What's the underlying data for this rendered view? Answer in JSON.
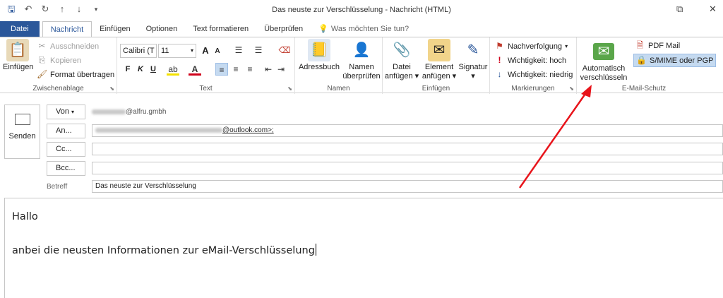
{
  "window": {
    "title": "Das neuste zur Verschlüsselung - Nachricht (HTML)",
    "restore_glyph": "⧉",
    "close_glyph": "✕"
  },
  "qat": [
    "save-icon",
    "undo-icon",
    "redo-icon",
    "up-icon",
    "down-icon",
    "customize-icon"
  ],
  "tabs": {
    "file": "Datei",
    "items": [
      "Nachricht",
      "Einfügen",
      "Optionen",
      "Text formatieren",
      "Überprüfen"
    ],
    "active": "Nachricht",
    "tell_me": "Was möchten Sie tun?"
  },
  "clipboard": {
    "label": "Zwischenablage",
    "paste": "Einfügen",
    "cut": "Ausschneiden",
    "copy": "Kopieren",
    "format_painter": "Format übertragen"
  },
  "text": {
    "label": "Text",
    "font": "Calibri (T",
    "size": "11",
    "bold": "F",
    "italic": "K",
    "underline": "U",
    "grow": "A",
    "shrink": "A"
  },
  "names": {
    "label": "Namen",
    "address_book": "Adressbuch",
    "check_names_1": "Namen",
    "check_names_2": "überprüfen"
  },
  "insert": {
    "label": "Einfügen",
    "attach_file_1": "Datei",
    "attach_file_2": "anfügen",
    "attach_item_1": "Element",
    "attach_item_2": "anfügen",
    "signature": "Signatur"
  },
  "tags": {
    "label": "Markierungen",
    "follow_up": "Nachverfolgung",
    "high": "Wichtigkeit: hoch",
    "low": "Wichtigkeit: niedrig"
  },
  "email_protection": {
    "label": "E-Mail-Schutz",
    "auto_encrypt_1": "Automatisch",
    "auto_encrypt_2": "verschlüsseln",
    "pdf_mail": "PDF Mail",
    "smime_pgp": "S/MIME oder PGP"
  },
  "compose": {
    "send": "Senden",
    "from_label": "Von",
    "from_value": "@alfru.gmbh",
    "to_label": "An...",
    "to_value": "@outlook.com>;",
    "cc_label": "Cc...",
    "bcc_label": "Bcc...",
    "subject_label": "Betreff",
    "subject_value": "Das neuste zur Verschlüsselung"
  },
  "body": {
    "line1": "Hallo",
    "line2": "anbei die neusten Informationen zur eMail-Verschlüsselung"
  },
  "colors": {
    "accent": "#2b579a",
    "annotation_arrow": "#e8141b",
    "selected": "#c5daf0"
  }
}
